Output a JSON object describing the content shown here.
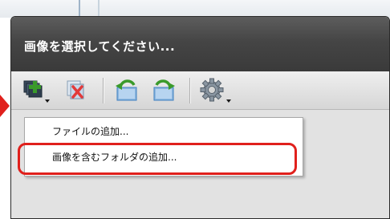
{
  "dialog": {
    "title": "画像を選択してください..."
  },
  "toolbar": {
    "buttons": [
      {
        "name": "add-images-icon",
        "has_dropdown": true
      },
      {
        "name": "remove-image-icon",
        "has_dropdown": false
      },
      {
        "name": "rotate-left-icon",
        "has_dropdown": false
      },
      {
        "name": "rotate-right-icon",
        "has_dropdown": false
      },
      {
        "name": "settings-gear-icon",
        "has_dropdown": true
      }
    ]
  },
  "menu": {
    "items": [
      {
        "label": "ファイルの追加..."
      },
      {
        "label": "画像を含むフォルダの追加..."
      }
    ],
    "highlighted_item": 1
  },
  "colors": {
    "titlebar": "#454545",
    "highlight": "#e0201c",
    "accent_green": "#3a9a2a",
    "accent_blue": "#3d7fc0"
  }
}
